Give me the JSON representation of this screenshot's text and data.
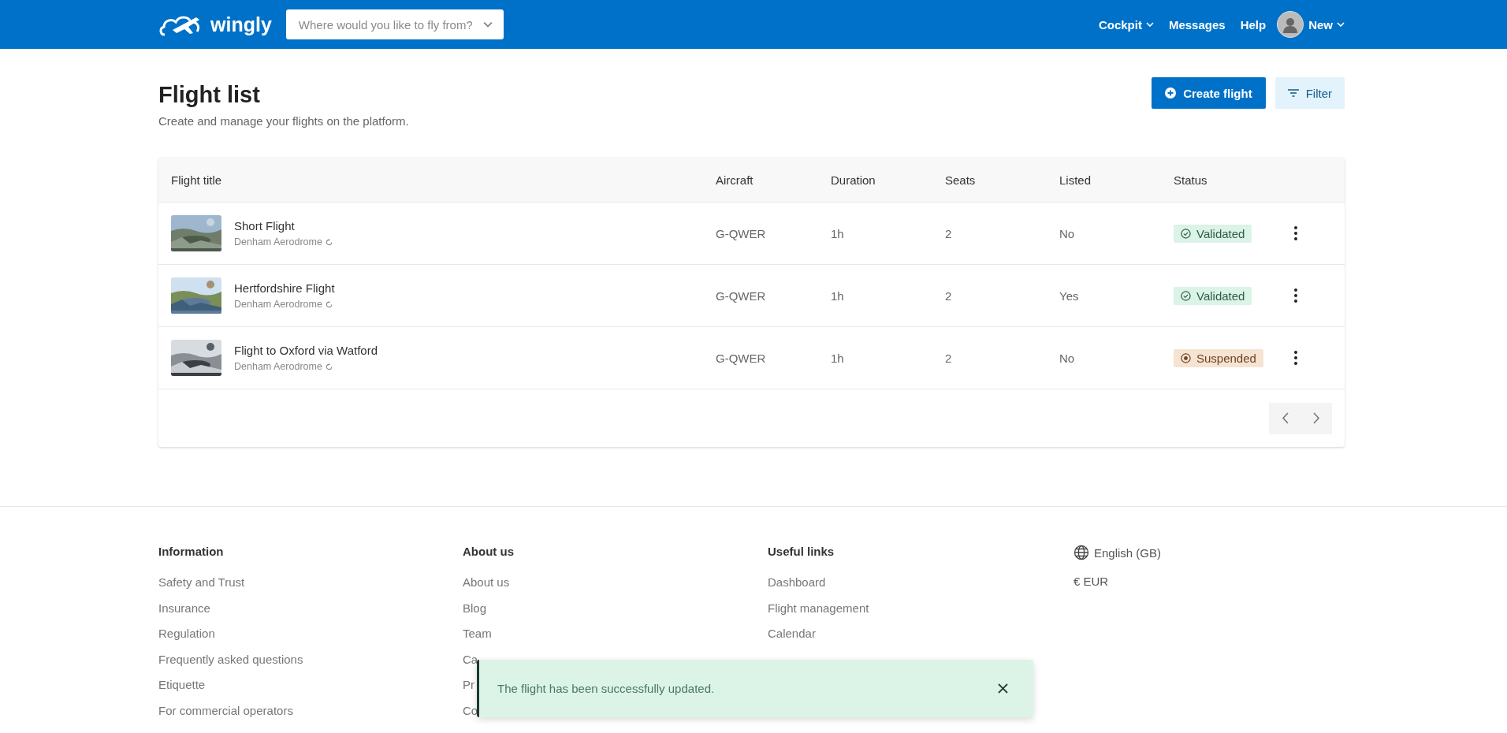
{
  "header": {
    "logo": "wingly",
    "search": {
      "placeholder": "Where would you like to fly from?"
    },
    "nav": [
      {
        "label": "Cockpit",
        "dropdown": true
      },
      {
        "label": "Messages",
        "dropdown": false
      },
      {
        "label": "Help",
        "dropdown": false
      }
    ],
    "user": {
      "label": "New"
    }
  },
  "page": {
    "title": "Flight list",
    "subtitle": "Create and manage your flights on the platform.",
    "create_button": "Create flight",
    "filter_button": "Filter"
  },
  "table": {
    "columns": [
      "Flight title",
      "Aircraft",
      "Duration",
      "Seats",
      "Listed",
      "Status"
    ],
    "rows": [
      {
        "title": "Short Flight",
        "airfield": "Denham Aerodrome",
        "aircraft": "G-QWER",
        "duration": "1h",
        "seats": "2",
        "listed": "No",
        "status": {
          "label": "Validated",
          "kind": "validated"
        }
      },
      {
        "title": "Hertfordshire Flight",
        "airfield": "Denham Aerodrome",
        "aircraft": "G-QWER",
        "duration": "1h",
        "seats": "2",
        "listed": "Yes",
        "status": {
          "label": "Validated",
          "kind": "validated"
        }
      },
      {
        "title": "Flight to Oxford via Watford",
        "airfield": "Denham Aerodrome",
        "aircraft": "G-QWER",
        "duration": "1h",
        "seats": "2",
        "listed": "No",
        "status": {
          "label": "Suspended",
          "kind": "suspended"
        }
      }
    ]
  },
  "footer": {
    "columns": [
      {
        "heading": "Information",
        "links": [
          "Safety and Trust",
          "Insurance",
          "Regulation",
          "Frequently asked questions",
          "Etiquette",
          "For commercial operators"
        ]
      },
      {
        "heading": "About us",
        "links": [
          "About us",
          "Blog",
          "Team",
          "Ca",
          "Pr",
          "Co"
        ]
      },
      {
        "heading": "Useful links",
        "links": [
          "Dashboard",
          "Flight management",
          "Calendar"
        ]
      }
    ],
    "language": "English (GB)",
    "currency": "€ EUR"
  },
  "toast": {
    "message": "The flight has been successfully updated."
  }
}
